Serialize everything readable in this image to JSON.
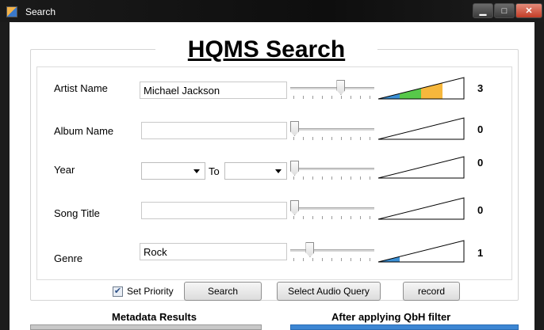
{
  "window": {
    "title": "Search"
  },
  "heading": "HQMS Search",
  "fields": {
    "artist": {
      "label": "Artist Name",
      "value": "Michael Jackson",
      "level": 3
    },
    "album": {
      "label": "Album Name",
      "value": "",
      "level": 0
    },
    "year": {
      "label": "Year",
      "to_label": "To",
      "from_value": "",
      "to_value": "",
      "level": 0
    },
    "song": {
      "label": "Song Title",
      "value": "",
      "level": 0
    },
    "genre": {
      "label": "Genre",
      "value": "Rock",
      "level": 1
    }
  },
  "level_max": 4,
  "level_colors": [
    "#3b8fd4",
    "#57c84a",
    "#f6b73c",
    "#ffffff"
  ],
  "controls": {
    "set_priority_label": "Set Priority",
    "set_priority_checked": true,
    "search_label": "Search",
    "select_audio_label": "Select Audio Query",
    "record_label": "record"
  },
  "sections": {
    "metadata_results": "Metadata Results",
    "qbh_filter": "After applying QbH filter"
  }
}
